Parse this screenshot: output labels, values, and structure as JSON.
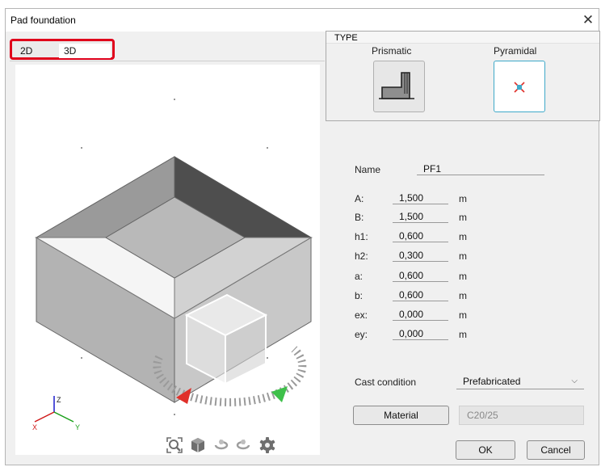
{
  "dialog": {
    "title": "Pad foundation",
    "close_glyph": "✕"
  },
  "view_tabs": [
    {
      "label": "2D"
    },
    {
      "label": "3D",
      "selected": true
    }
  ],
  "type_panel": {
    "legend": "TYPE",
    "options": [
      {
        "label": "Prismatic",
        "icon": "prismatic-foundation-icon"
      },
      {
        "label": "Pyramidal",
        "icon": "pyramidal-foundation-icon",
        "selected": true
      }
    ]
  },
  "name_field": {
    "label": "Name",
    "value": "PF1"
  },
  "parameters": [
    {
      "label": "A:",
      "value": "1,500",
      "unit": "m"
    },
    {
      "label": "B:",
      "value": "1,500",
      "unit": "m"
    },
    {
      "label": "h1:",
      "value": "0,600",
      "unit": "m"
    },
    {
      "label": "h2:",
      "value": "0,300",
      "unit": "m"
    },
    {
      "label": "a:",
      "value": "0,600",
      "unit": "m"
    },
    {
      "label": "b:",
      "value": "0,600",
      "unit": "m"
    },
    {
      "label": "ex:",
      "value": "0,000",
      "unit": "m"
    },
    {
      "label": "ey:",
      "value": "0,000",
      "unit": "m"
    }
  ],
  "cast_condition": {
    "label": "Cast condition",
    "value": "Prefabricated"
  },
  "material": {
    "button_label": "Material",
    "value": "C20/25"
  },
  "buttons": {
    "ok": "OK",
    "cancel": "Cancel"
  },
  "axes": {
    "x": "X",
    "y": "Y",
    "z": "Z"
  },
  "toolbar_icons": [
    "zoom-fit-icon",
    "view-cube-icon",
    "rotate-left-icon",
    "rotate-right-icon",
    "settings-gear-icon"
  ],
  "colors": {
    "highlight_red": "#e0001b",
    "rotate_red": "#e0302a",
    "rotate_green": "#3ec04a",
    "selected_border": "#3fa9c9"
  }
}
